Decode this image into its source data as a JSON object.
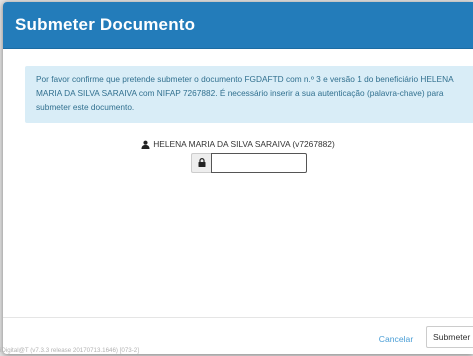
{
  "modal": {
    "title": "Submeter Documento"
  },
  "alert": {
    "message": "Por favor confirme que pretende submeter o documento FGDAFTD com n.º 3 e versão 1 do beneficiário HELENA MARIA DA SILVA SARAIVA com NIFAP 7267882. É necessário inserir a sua autenticação (palavra-chave) para submeter este documento."
  },
  "user": {
    "icon": "user-icon",
    "label": "HELENA MARIA DA SILVA SARAIVA (v7267882)"
  },
  "password": {
    "icon": "lock-icon",
    "value": "",
    "placeholder": ""
  },
  "footer": {
    "cancel_label": "Cancelar",
    "submit_label": "Submeter",
    "version_text": "iDigital@T (v7.3.3 release 20170713.1646) [073-2]"
  },
  "colors": {
    "header": "#237cba",
    "alert_bg": "#d9edf7",
    "alert_text": "#31708f",
    "link": "#4a9ed6"
  }
}
